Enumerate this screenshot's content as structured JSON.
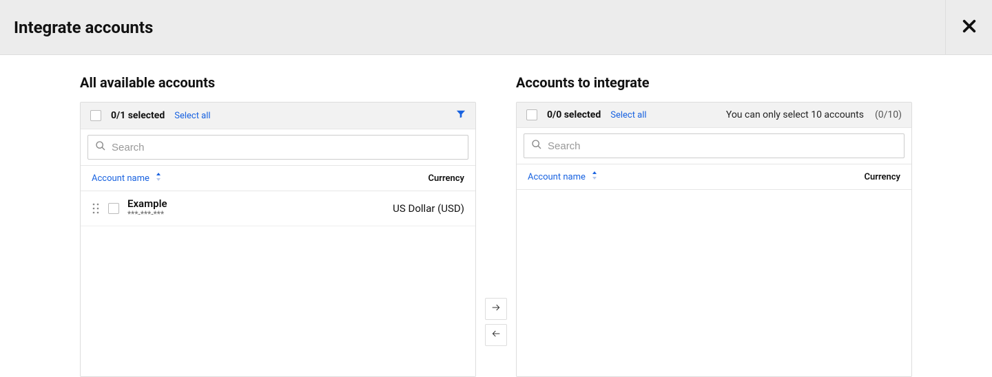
{
  "header": {
    "title": "Integrate accounts"
  },
  "left": {
    "title": "All available accounts",
    "selected_text": "0/1 selected",
    "select_all_label": "Select all",
    "search_placeholder": "Search",
    "col_account_name": "Account name",
    "col_currency": "Currency",
    "rows": [
      {
        "name": "Example",
        "mask": "***-***-***",
        "currency": "US Dollar (USD)"
      }
    ]
  },
  "right": {
    "title": "Accounts to integrate",
    "selected_text": "0/0 selected",
    "select_all_label": "Select all",
    "limit_text": "You can only select 10 accounts",
    "limit_count": "(0/10)",
    "search_placeholder": "Search",
    "col_account_name": "Account name",
    "col_currency": "Currency"
  }
}
